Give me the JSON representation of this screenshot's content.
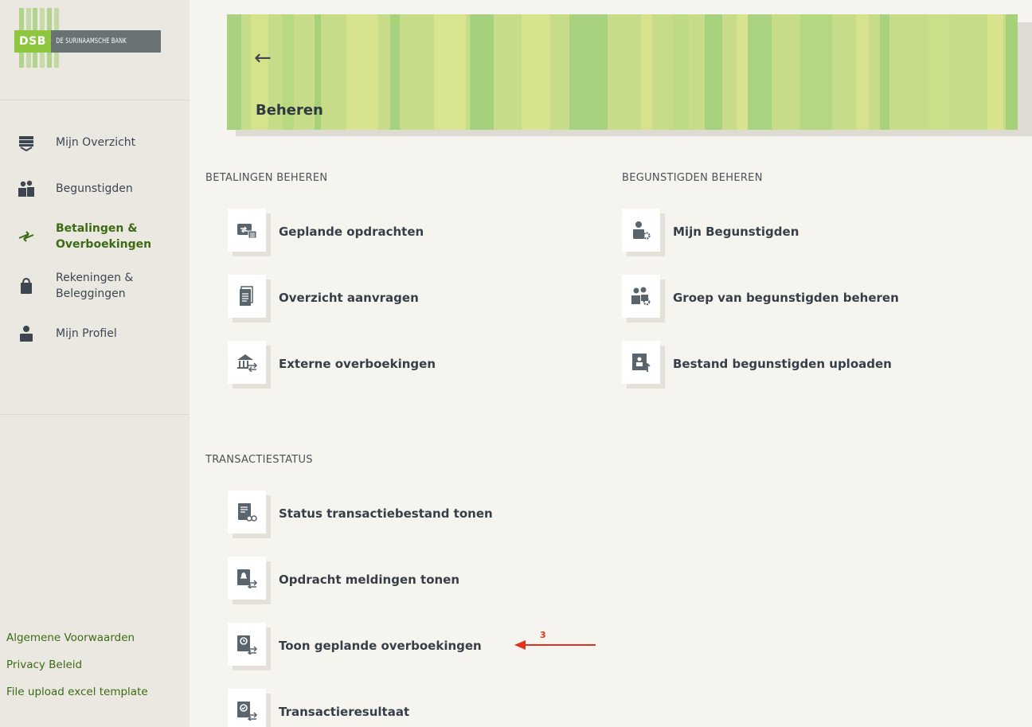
{
  "brand": {
    "logo_mark": "DSB",
    "bank_name": "DE SURINAAMSCHE BANK",
    "accent": "#8ec63f"
  },
  "sidebar": {
    "items": [
      {
        "label": "Mijn Overzicht",
        "icon": "overview-icon",
        "active": false
      },
      {
        "label": "Begunstigden",
        "icon": "beneficiaries-icon",
        "active": false
      },
      {
        "label": "Betalingen &\nOverboekingen",
        "icon": "transfer-arrows-icon",
        "active": true
      },
      {
        "label": "Rekeningen &\nBeleggingen",
        "icon": "bag-icon",
        "active": false
      },
      {
        "label": "Mijn Profiel",
        "icon": "profile-icon",
        "active": false
      }
    ],
    "footer_links": [
      "Algemene Voorwaarden",
      "Privacy Beleid",
      "File upload excel template"
    ]
  },
  "header": {
    "back_symbol": "←",
    "title": "Beheren"
  },
  "sections": {
    "payments": {
      "title": "BETALINGEN BEHEREN",
      "items": [
        {
          "label": "Geplande opdrachten",
          "icon": "scheduled-transfer-icon"
        },
        {
          "label": "Overzicht aanvragen",
          "icon": "document-icon"
        },
        {
          "label": "Externe overboekingen",
          "icon": "bank-transfer-icon"
        }
      ]
    },
    "beneficiaries": {
      "title": "BEGUNSTIGDEN BEHEREN",
      "items": [
        {
          "label": "Mijn Begunstigden",
          "icon": "user-gear-icon"
        },
        {
          "label": "Groep van begunstigden beheren",
          "icon": "group-gear-icon"
        },
        {
          "label": "Bestand begunstigden uploaden",
          "icon": "file-upload-icon"
        }
      ]
    },
    "status": {
      "title": "TRANSACTIESTATUS",
      "items": [
        {
          "label": "Status transactiebestand tonen",
          "icon": "file-status-icon"
        },
        {
          "label": "Opdracht meldingen tonen",
          "icon": "notification-transfer-icon"
        },
        {
          "label": "Toon geplande overboekingen",
          "icon": "scheduled-list-icon"
        },
        {
          "label": "Transactieresultaat",
          "icon": "result-check-icon"
        }
      ]
    }
  },
  "annotation": {
    "number": "3",
    "color": "#e0321f"
  }
}
